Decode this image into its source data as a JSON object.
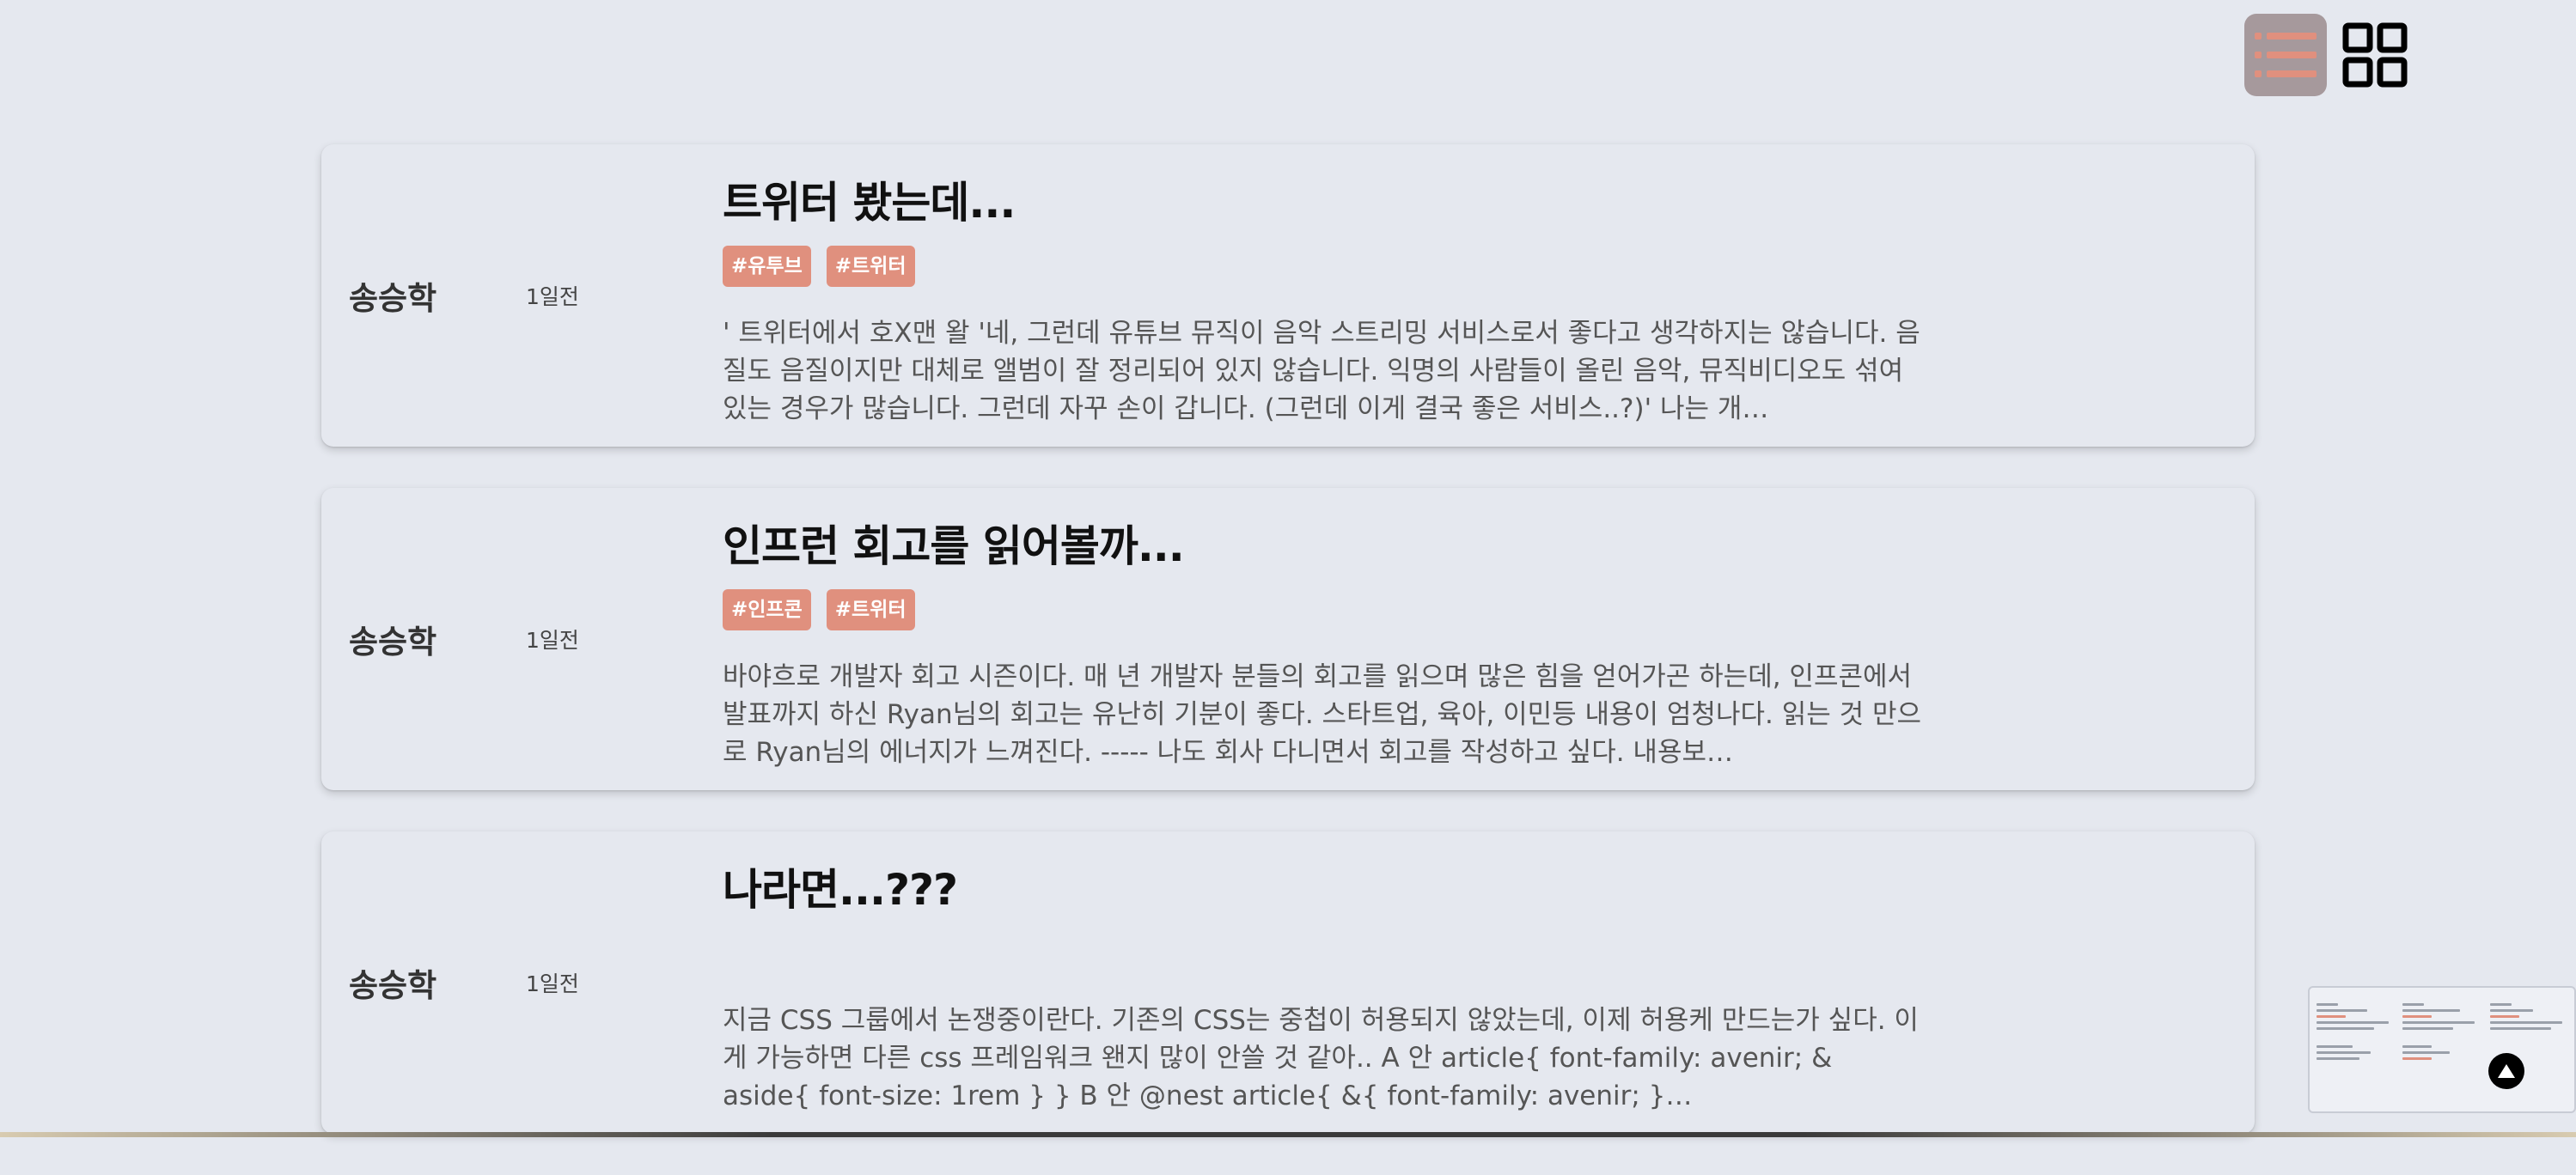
{
  "view_toggle": {
    "list_icon": "list-icon",
    "grid_icon": "grid-icon",
    "active": "list"
  },
  "posts": [
    {
      "author": "송승학",
      "date": "1일전",
      "title": "트위터 봤는데...",
      "tags": [
        "#유투브",
        "#트위터"
      ],
      "excerpt": "' 트위터에서 호X맨 왈 '네, 그런데 유튜브 뮤직이 음악 스트리밍 서비스로서 좋다고 생각하지는 않습니다. 음질도 음질이지만 대체로 앨범이 잘 정리되어 있지 않습니다. 익명의 사람들이 올린 음악, 뮤직비디오도 섞여 있는 경우가 많습니다. 그런데 자꾸 손이 갑니다. (그런데 이게 결국 좋은 서비스..?)' 나는 개…"
    },
    {
      "author": "송승학",
      "date": "1일전",
      "title": "인프런 회고를 읽어볼까...",
      "tags": [
        "#인프콘",
        "#트위터"
      ],
      "excerpt": "바야흐로 개발자 회고 시즌이다. 매 년 개발자 분들의 회고를 읽으며 많은 힘을 얻어가곤 하는데, 인프콘에서 발표까지 하신 Ryan님의 회고는 유난히 기분이 좋다. 스타트업, 육아, 이민등 내용이 엄청나다. 읽는 것 만으로 Ryan님의 에너지가 느껴진다. ----- 나도 회사 다니면서 회고를 작성하고 싶다. 내용보…"
    },
    {
      "author": "송승학",
      "date": "1일전",
      "title": "나라면...???",
      "tags": [],
      "excerpt": "지금 CSS 그룹에서 논쟁중이란다. 기존의 CSS는 중첩이 허용되지 않았는데, 이제 허용케 만드는가 싶다. 이게 가능하면 다른 css 프레임워크 왠지 많이 안쓸 것 같아.. A 안 article{ font-family: avenir; & aside{ font-size: 1rem } } B 안 @nest article{ &{ font-family: avenir; }…"
    }
  ],
  "thumbnail": {
    "scroll_top_icon": "arrow-up-icon"
  },
  "colors": {
    "background": "#e5e8ef",
    "tag": "#e0907e",
    "active_toggle": "#a6999c"
  }
}
